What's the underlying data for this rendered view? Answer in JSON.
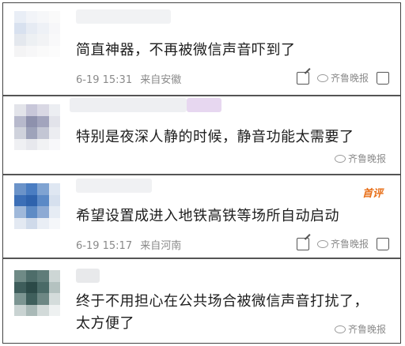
{
  "comments": [
    {
      "text": "简直神器，不再被微信声音吓到了",
      "date": "6-19 15:31",
      "location": "来自安徽",
      "watermark": "齐鲁晚报"
    },
    {
      "text": "特别是夜深人静的时候，静音功能太需要了",
      "watermark": "齐鲁晚报"
    },
    {
      "badge": "首评",
      "text": "希望设置成进入地铁高铁等场所自动启动",
      "date": "6-19 15:17",
      "location": "来自河南",
      "watermark": "齐鲁晚报"
    },
    {
      "text": "终于不用担心在公共场合被微信声音打扰了，太方便了",
      "watermark": "齐鲁晚报"
    }
  ],
  "icons": {
    "share": "share-icon",
    "like": "like-icon",
    "watermark": "wechat-icon"
  }
}
